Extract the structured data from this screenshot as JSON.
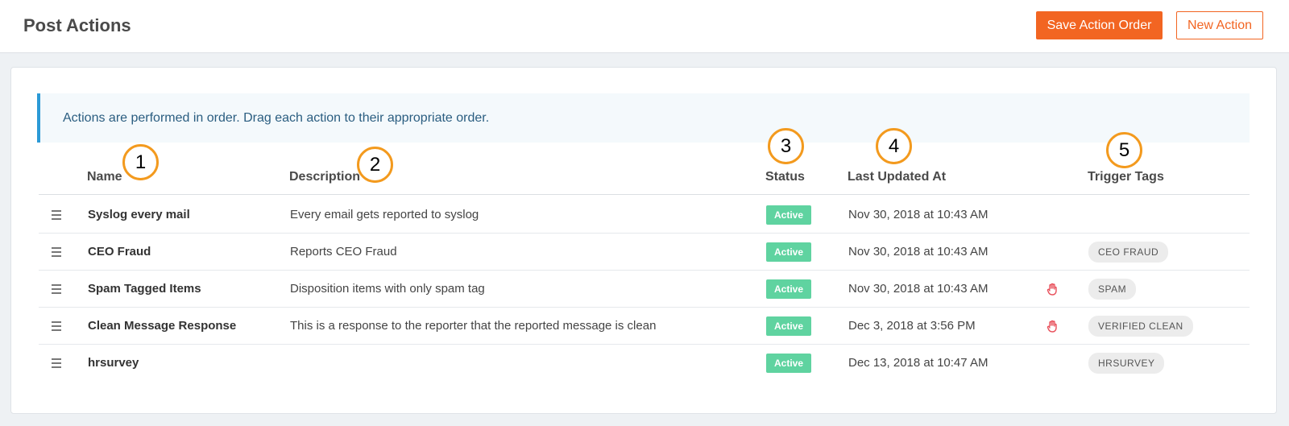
{
  "header": {
    "title": "Post Actions",
    "save_order_label": "Save Action Order",
    "new_action_label": "New Action"
  },
  "info_text": "Actions are performed in order. Drag each action to their appropriate order.",
  "columns": {
    "name": "Name",
    "description": "Description",
    "status": "Status",
    "updated": "Last Updated At",
    "tags": "Trigger Tags"
  },
  "markers": [
    "1",
    "2",
    "3",
    "4",
    "5"
  ],
  "rows": [
    {
      "name": "Syslog every mail",
      "description": "Every email gets reported to syslog",
      "status": "Active",
      "updated": "Nov 30, 2018 at 10:43 AM",
      "has_hand_icon": false,
      "tag": ""
    },
    {
      "name": "CEO Fraud",
      "description": "Reports CEO Fraud",
      "status": "Active",
      "updated": "Nov 30, 2018 at 10:43 AM",
      "has_hand_icon": false,
      "tag": "CEO FRAUD"
    },
    {
      "name": "Spam Tagged Items",
      "description": "Disposition items with only spam tag",
      "status": "Active",
      "updated": "Nov 30, 2018 at 10:43 AM",
      "has_hand_icon": true,
      "tag": "SPAM"
    },
    {
      "name": "Clean Message Response",
      "description": "This is a response to the reporter that the reported message is clean",
      "status": "Active",
      "updated": "Dec 3, 2018 at 3:56 PM",
      "has_hand_icon": true,
      "tag": "VERIFIED CLEAN"
    },
    {
      "name": "hrsurvey",
      "description": "",
      "status": "Active",
      "updated": "Dec 13, 2018 at 10:47 AM",
      "has_hand_icon": false,
      "tag": "HRSURVEY"
    }
  ],
  "colors": {
    "accent": "#f26522",
    "status_active": "#5fd3a0",
    "info_border": "#2c9ad6",
    "marker_ring": "#f39a1e",
    "hand_icon": "#e8505b"
  },
  "icons": {
    "drag": "drag-handle-icon",
    "hand": "hand-stop-icon"
  }
}
